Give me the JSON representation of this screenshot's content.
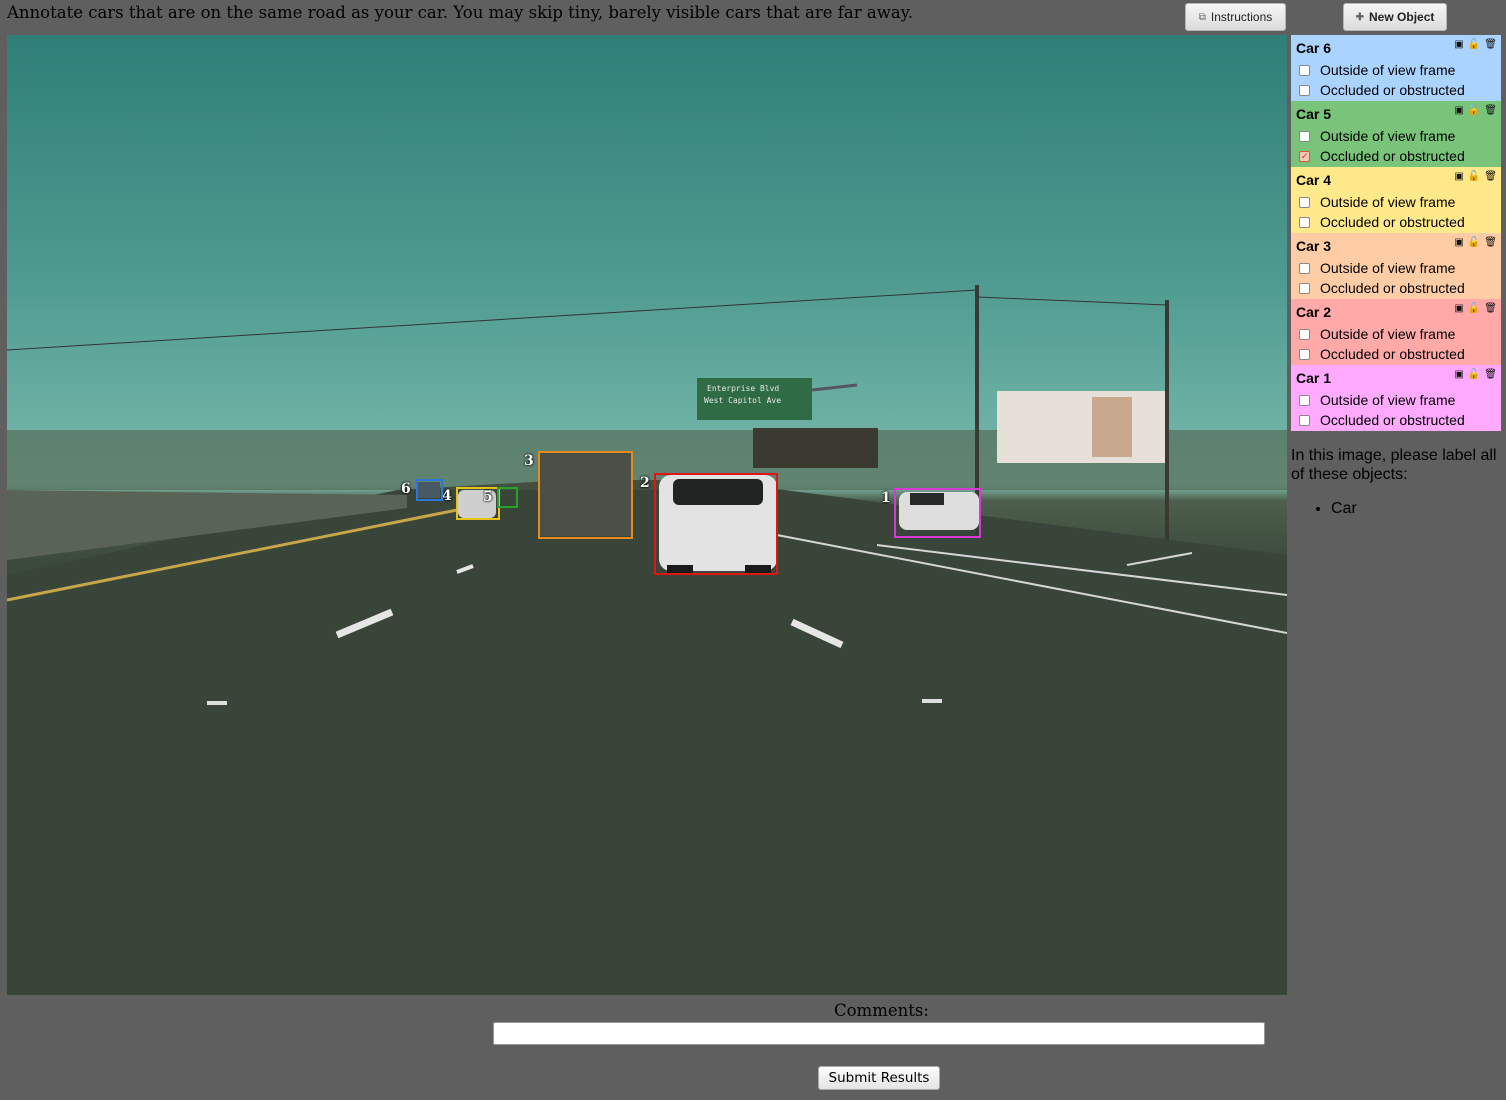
{
  "instruction": "Annotate cars that are on the same road as your car. You may skip tiny, barely visible cars that are far away.",
  "toolbar": {
    "instructions_label": "Instructions",
    "new_object_label": "New Object"
  },
  "sign": {
    "line1": "Enterprise Blvd",
    "line2": "West Capitol Ave"
  },
  "objects": [
    {
      "title": "Car 6",
      "color": "#aad4ff",
      "outside": "Outside of view frame",
      "occluded": "Occluded or obstructed",
      "outside_checked": false,
      "occluded_checked": false
    },
    {
      "title": "Car 5",
      "color": "#79c37a",
      "outside": "Outside of view frame",
      "occluded": "Occluded or obstructed",
      "outside_checked": false,
      "occluded_checked": true
    },
    {
      "title": "Car 4",
      "color": "#ffe98a",
      "outside": "Outside of view frame",
      "occluded": "Occluded or obstructed",
      "outside_checked": false,
      "occluded_checked": false
    },
    {
      "title": "Car 3",
      "color": "#ffcda5",
      "outside": "Outside of view frame",
      "occluded": "Occluded or obstructed",
      "outside_checked": false,
      "occluded_checked": false
    },
    {
      "title": "Car 2",
      "color": "#ffa9a9",
      "outside": "Outside of view frame",
      "occluded": "Occluded or obstructed",
      "outside_checked": false,
      "occluded_checked": false
    },
    {
      "title": "Car 1",
      "color": "#ffa9ff",
      "outside": "Outside of view frame",
      "occluded": "Occluded or obstructed",
      "outside_checked": false,
      "occluded_checked": false
    }
  ],
  "annotations": [
    {
      "label": "1",
      "color": "#d63ad6"
    },
    {
      "label": "2",
      "color": "#e01515"
    },
    {
      "label": "3",
      "color": "#e58a1c"
    },
    {
      "label": "4",
      "color": "#e7c21b"
    },
    {
      "label": "5",
      "color": "#2aa12a"
    },
    {
      "label": "6",
      "color": "#2b78d6"
    }
  ],
  "prompt": {
    "text": "In this image, please label all of these objects:",
    "items": [
      "Car"
    ]
  },
  "comments": {
    "label": "Comments:",
    "value": ""
  },
  "submit_label": "Submit Results"
}
